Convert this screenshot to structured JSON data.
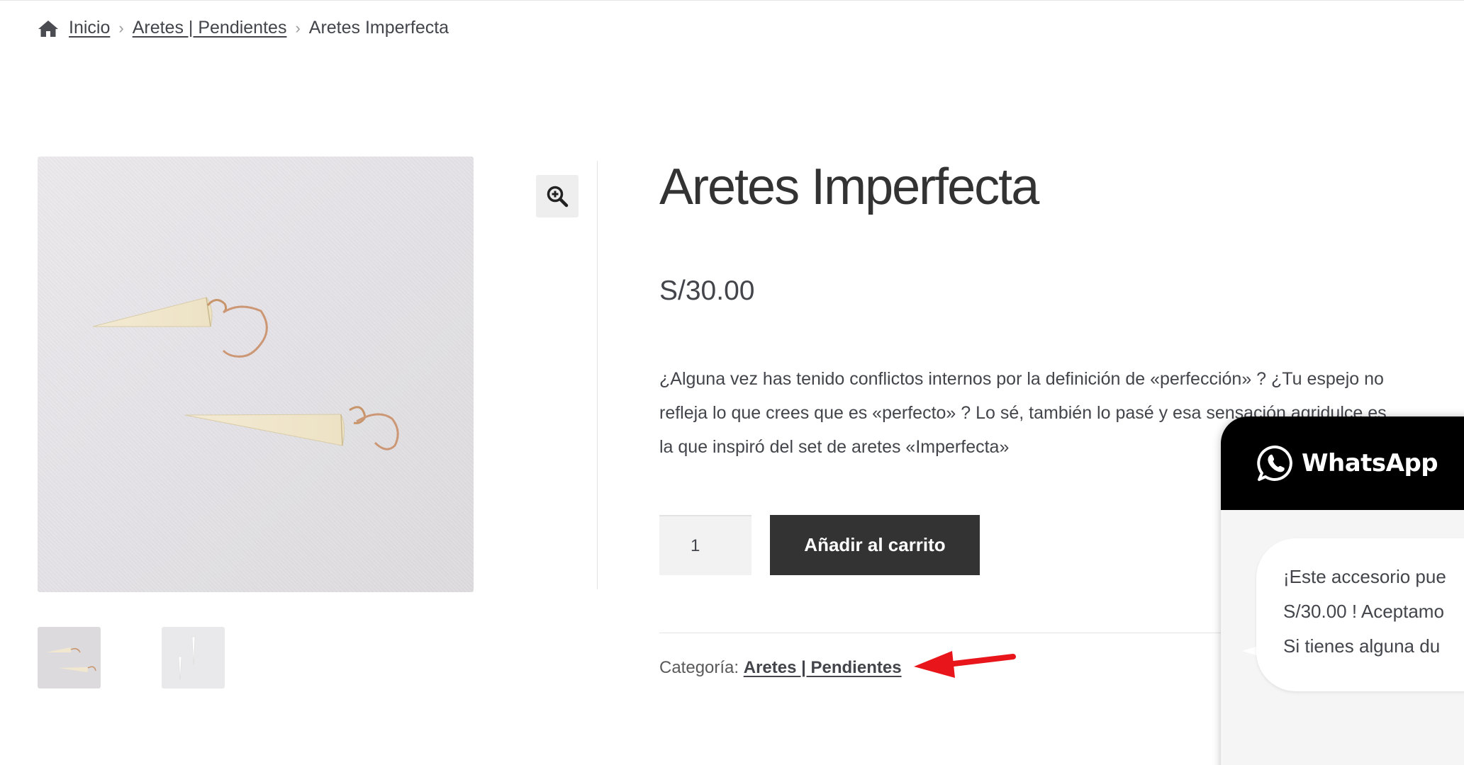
{
  "breadcrumb": {
    "home_icon": "home-icon",
    "items": [
      "Inicio",
      "Aretes | Pendientes",
      "Aretes Imperfecta"
    ]
  },
  "gallery": {
    "zoom_icon": "zoom-in-icon"
  },
  "product": {
    "title": "Aretes Imperfecta",
    "price": "S/30.00",
    "description_lines": [
      "¿Alguna vez has tenido conflictos internos por la definición de «perfección» ? ¿Tu espejo no",
      "refleja lo que crees que es «perfecto» ? Lo sé, también lo pasé y esa sensación agridulce es",
      "la que inspiró del set de aretes «Imperfecta»"
    ],
    "quantity": "1",
    "add_to_cart_label": "Añadir al carrito",
    "category_label": "Categoría:",
    "category_link": "Aretes | Pendientes"
  },
  "annotation": {
    "arrow_color": "#e8161b"
  },
  "whatsapp": {
    "brand": "WhatsApp",
    "header_color": "#000000",
    "message_lines": [
      "¡Este accesorio pue",
      "S/30.00 ! Aceptamo",
      "Si tienes alguna du"
    ]
  }
}
